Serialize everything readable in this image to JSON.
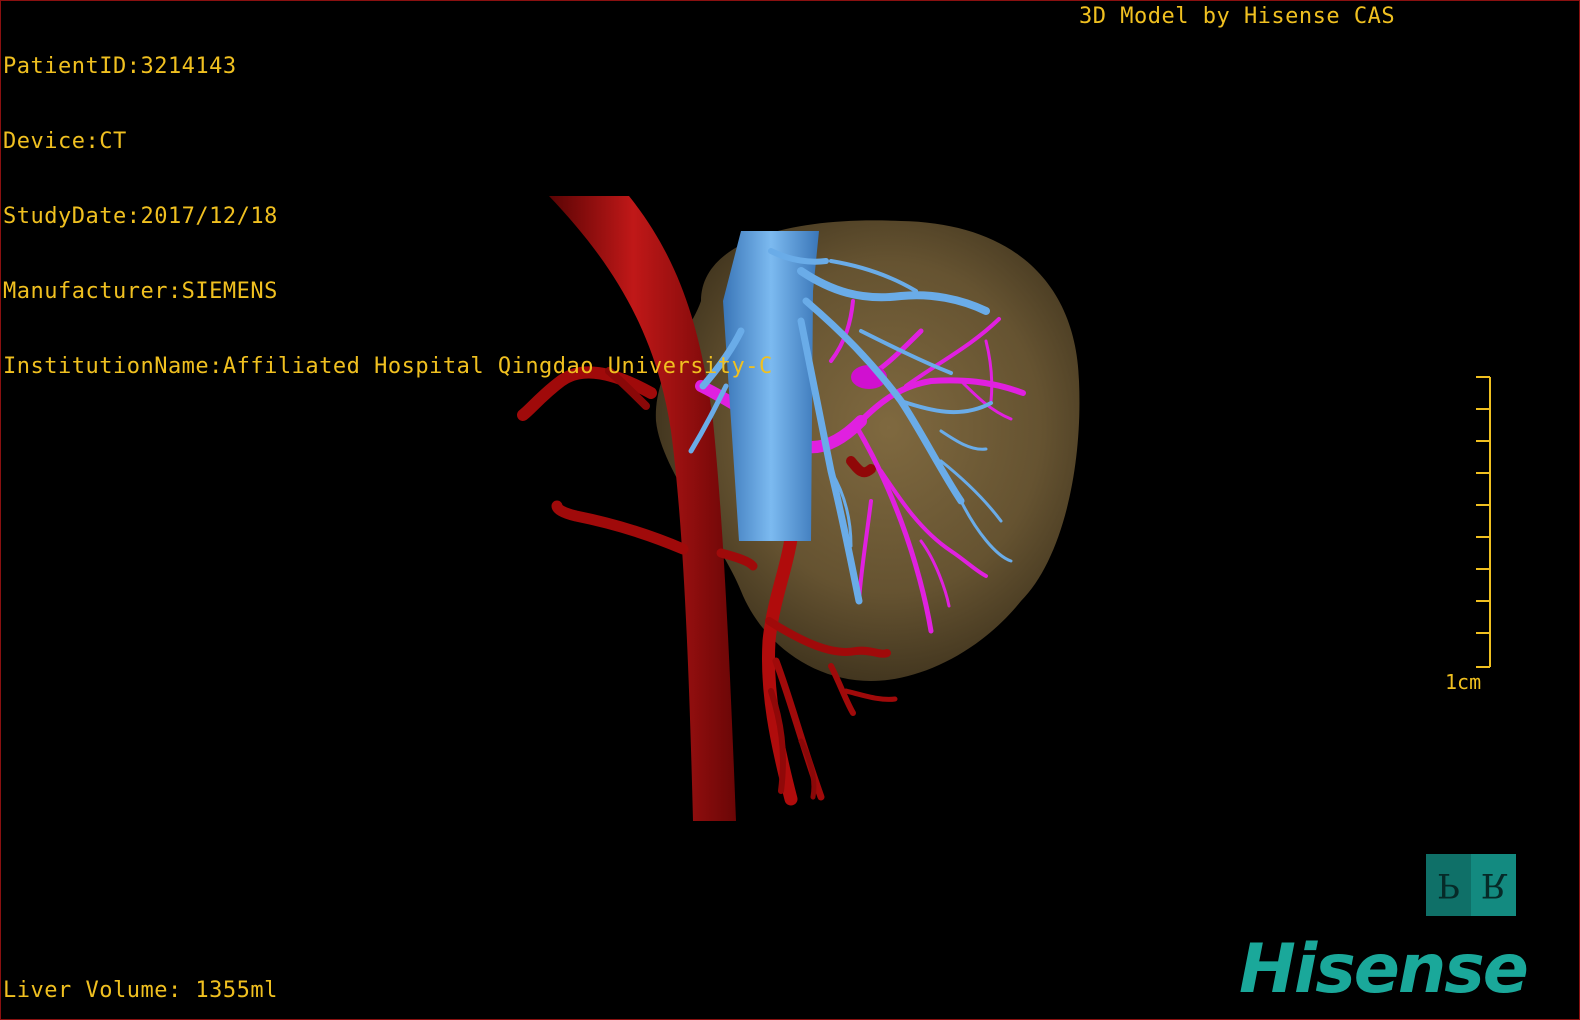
{
  "patient_info": {
    "patient_id": "PatientID:3214143",
    "device": "Device:CT",
    "study_date": "StudyDate:2017/12/18",
    "manufacturer": "Manufacturer:SIEMENS",
    "institution": "InstitutionName:Affiliated Hospital Qingdao University-C"
  },
  "model_credit": "3D Model by Hisense CAS",
  "liver_volume": "Liver Volume: 1355ml",
  "scale": {
    "label": "1cm"
  },
  "orientation": {
    "left_face": "P",
    "right_face": "R"
  },
  "brand": "Hisense",
  "colors": {
    "overlay_text": "#f0c020",
    "liver": "#6e5a35",
    "artery": "#b00c0c",
    "portal_vein": "#e020e0",
    "hepatic_vein": "#5aa0e0",
    "brand": "#1aa89a"
  }
}
